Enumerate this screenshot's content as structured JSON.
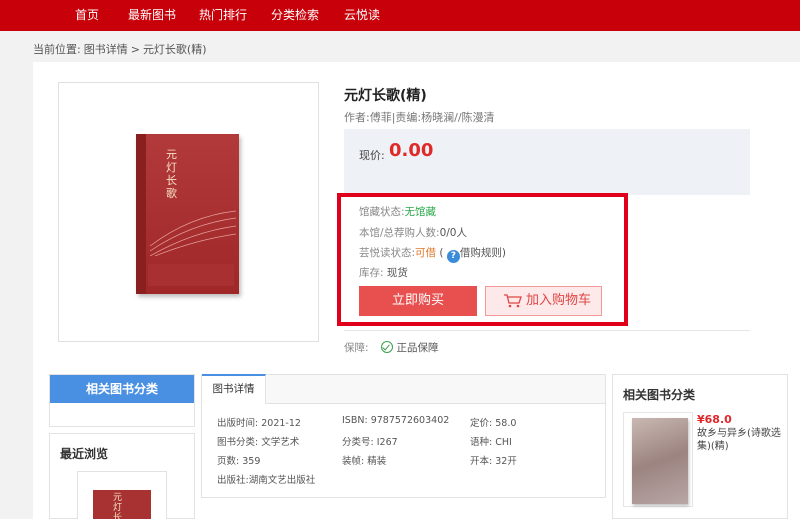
{
  "nav": [
    "首页",
    "最新图书",
    "热门排行",
    "分类检索",
    "云悦读"
  ],
  "breadcrumb": {
    "prefix": "当前位置:",
    "item1": "图书详情",
    "sep": ">",
    "item2": "元灯长歌(精)"
  },
  "book": {
    "cover_title": "元灯长歌",
    "title": "元灯长歌(精)",
    "author": "作者:傅菲|责编:杨晓澜//陈漫清",
    "price_label": "现价:",
    "price": "0.00"
  },
  "status": {
    "library_label": "馆藏状态:",
    "library_value": "无馆藏",
    "buyers_label": "本馆/总荐购人数:",
    "buyers_value": "0/0人",
    "yunyue_label": "芸悦读状态:",
    "yunyue_value": "可借",
    "paren_open": "(",
    "rule_link": "借购规则",
    "paren_close": ")",
    "stock_label": "库存:",
    "stock_value": "现货",
    "help_icon": "?"
  },
  "actions": {
    "buy": "立即购买",
    "cart": "加入购物车"
  },
  "guarantee": {
    "label": "保障:",
    "value": "正品保障"
  },
  "left_sidebar": {
    "category_tab": "相关图书分类",
    "recent_title": "最近浏览"
  },
  "detail": {
    "tab": "图书详情",
    "attrs": [
      {
        "label": "出版时间:",
        "value": "2021-12"
      },
      {
        "label": "ISBN:",
        "value": "9787572603402"
      },
      {
        "label": "定价:",
        "value": "58.0"
      },
      {
        "label": "图书分类:",
        "value": "文学艺术"
      },
      {
        "label": "分类号:",
        "value": "I267"
      },
      {
        "label": "语种:",
        "value": "CHI"
      },
      {
        "label": "页数:",
        "value": "359"
      },
      {
        "label": "装帧:",
        "value": "精装"
      },
      {
        "label": "开本:",
        "value": "32开"
      },
      {
        "label": "出版社:",
        "value": "湖南文艺出版社"
      }
    ]
  },
  "right_sidebar": {
    "title": "相关图书分类",
    "item": {
      "price": "¥68.0",
      "name": "故乡与异乡(诗歌选集)(精)"
    }
  },
  "colors": {
    "nav_bg": "#c8000a",
    "price": "#e02a2a",
    "buy_btn": "#e8504f",
    "highlight": "#e0001b",
    "tab_blue": "#4a90e2"
  }
}
